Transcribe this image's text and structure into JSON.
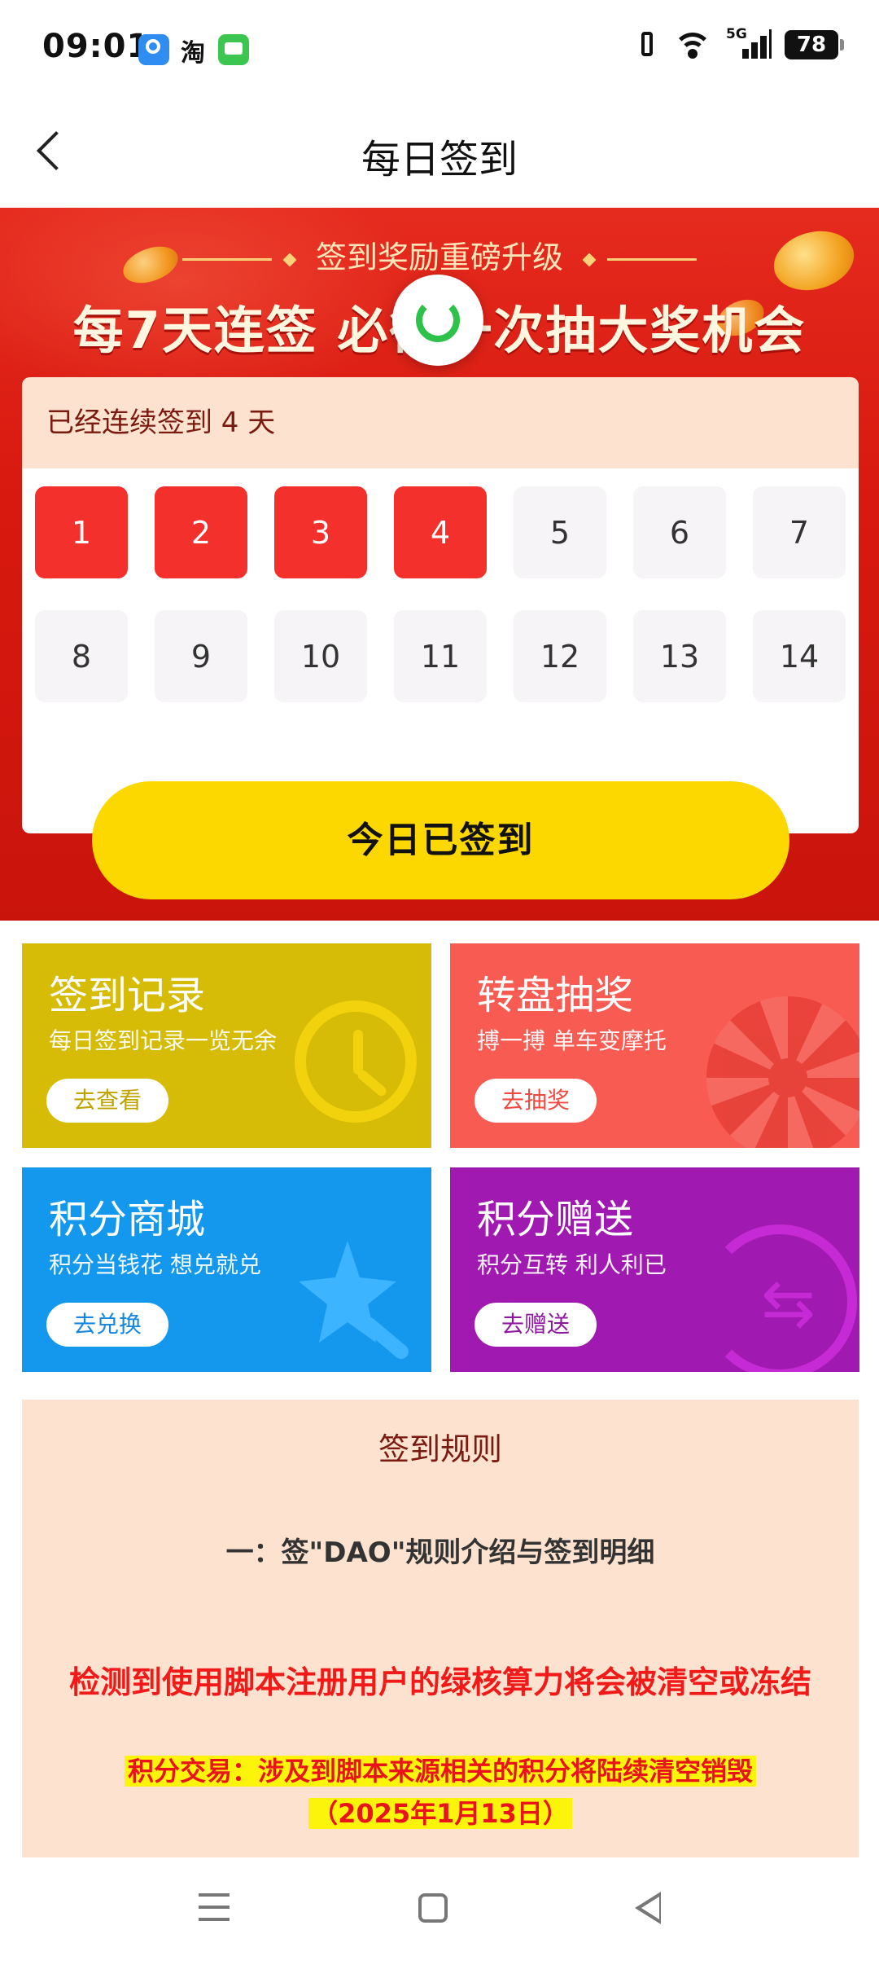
{
  "status": {
    "time": "09:01",
    "network": "5G",
    "battery": "78",
    "app_taobao": "淘"
  },
  "header": {
    "title": "每日签到"
  },
  "banner": {
    "subtitle": "签到奖励重磅升级",
    "headline": "每7天连签  必得一次抽大奖机会"
  },
  "checkin": {
    "streak_text": "已经连续签到 4 天",
    "days": [
      {
        "label": "1",
        "done": true
      },
      {
        "label": "2",
        "done": true
      },
      {
        "label": "3",
        "done": true
      },
      {
        "label": "4",
        "done": true
      },
      {
        "label": "5",
        "done": false
      },
      {
        "label": "6",
        "done": false
      },
      {
        "label": "7",
        "done": false
      },
      {
        "label": "8",
        "done": false
      },
      {
        "label": "9",
        "done": false
      },
      {
        "label": "10",
        "done": false
      },
      {
        "label": "11",
        "done": false
      },
      {
        "label": "12",
        "done": false
      },
      {
        "label": "13",
        "done": false
      },
      {
        "label": "14",
        "done": false
      }
    ],
    "button_label": "今日已签到"
  },
  "features": [
    {
      "title": "签到记录",
      "subtitle": "每日签到记录一览无余",
      "button": "去查看",
      "icon": "clock-icon"
    },
    {
      "title": "转盘抽奖",
      "subtitle": "搏一搏 单车变摩托",
      "button": "去抽奖",
      "icon": "wheel-icon"
    },
    {
      "title": "积分商城",
      "subtitle": "积分当钱花 想兑就兑",
      "button": "去兑换",
      "icon": "magic-wand-icon"
    },
    {
      "title": "积分赠送",
      "subtitle": "积分互转 利人利已",
      "button": "去赠送",
      "icon": "transfer-icon"
    }
  ],
  "rules": {
    "title": "签到规则",
    "subtitle": "一：签\"DAO\"规则介绍与签到明细",
    "warning": "检测到使用脚本注册用户的绿核算力将会被清空或冻结",
    "note_line1": "积分交易：涉及到脚本来源相关的积分将陆续清空销毁",
    "note_line2": "（2025年1月13日）"
  },
  "colors": {
    "accent_red": "#f3302c",
    "button_yellow": "#fcd700",
    "card_yellow": "#d6bc07",
    "card_red": "#f85b52",
    "card_blue": "#1498ee",
    "card_purple": "#a01ab1"
  }
}
